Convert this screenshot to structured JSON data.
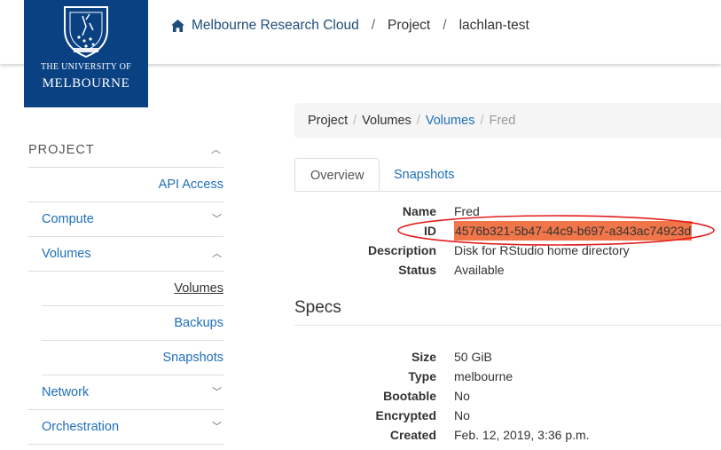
{
  "logo": {
    "line1": "THE UNIVERSITY OF",
    "line2": "MELBOURNE"
  },
  "header": {
    "home_icon": "home-icon",
    "crumbs": [
      "Melbourne Research Cloud",
      "Project",
      "lachlan-test"
    ],
    "separator": "/"
  },
  "sidebar": {
    "heading": "PROJECT",
    "items": {
      "api_access": "API Access",
      "compute": "Compute",
      "volumes": "Volumes",
      "volumes_sub": [
        "Volumes",
        "Backups",
        "Snapshots"
      ],
      "network": "Network",
      "orchestration": "Orchestration"
    }
  },
  "page_breadcrumb": [
    "Project",
    "Volumes",
    "Volumes",
    "Fred"
  ],
  "tabs": [
    "Overview",
    "Snapshots"
  ],
  "overview": [
    {
      "key": "Name",
      "value": "Fred"
    },
    {
      "key": "ID",
      "value": "4576b321-5b47-44c9-b697-a343ac74923d"
    },
    {
      "key": "Description",
      "value": "Disk for RStudio home directory"
    },
    {
      "key": "Status",
      "value": "Available"
    }
  ],
  "specs_title": "Specs",
  "specs": [
    {
      "key": "Size",
      "value": "50 GiB"
    },
    {
      "key": "Type",
      "value": "melbourne"
    },
    {
      "key": "Bootable",
      "value": "No"
    },
    {
      "key": "Encrypted",
      "value": "No"
    },
    {
      "key": "Created",
      "value": "Feb. 12, 2019, 3:36 p.m."
    }
  ],
  "colors": {
    "brand": "#094183",
    "link": "#1e6fb8",
    "highlight": "#f0764a",
    "annotation": "#e02020"
  }
}
